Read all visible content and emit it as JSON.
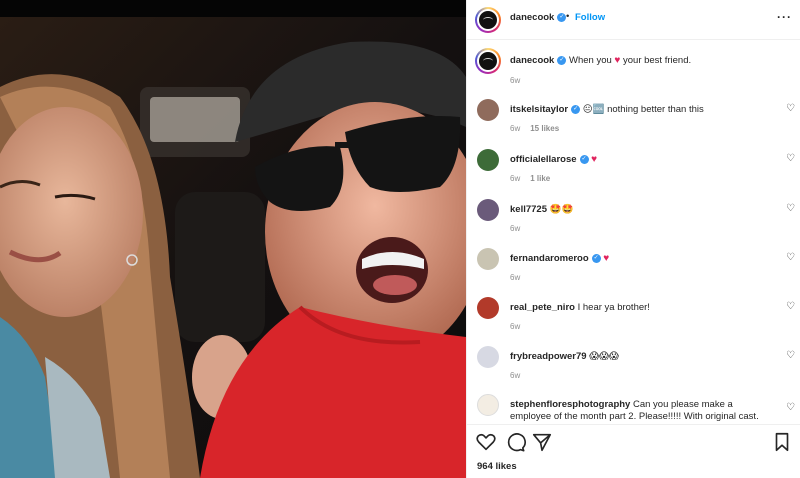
{
  "post": {
    "author": "danecook",
    "follow_label": "Follow",
    "separator": "•",
    "more_label": "···",
    "caption_text": "When you",
    "caption_text_end": "your best friend.",
    "caption_time": "6w",
    "likes": "964 likes"
  },
  "comments": [
    {
      "user": "itskelsitaylor",
      "verified": true,
      "text": "😐🆒 nothing better than this",
      "time": "6w",
      "likes": "15 likes"
    },
    {
      "user": "officialellarose",
      "verified": true,
      "text": "♥",
      "time": "6w",
      "likes": "1 like"
    },
    {
      "user": "kell7725",
      "verified": false,
      "text": "🤩🤩",
      "time": "6w",
      "likes": ""
    },
    {
      "user": "fernandaromeroo",
      "verified": true,
      "text": "♥",
      "time": "6w",
      "likes": ""
    },
    {
      "user": "real_pete_niro",
      "verified": false,
      "text": "I hear ya brother!",
      "time": "6w",
      "likes": ""
    },
    {
      "user": "frybreadpower79",
      "verified": false,
      "text": "😱😱😱",
      "time": "6w",
      "likes": ""
    },
    {
      "user": "stephenfloresphotography",
      "verified": false,
      "text": "Can you please make a employee of the month part 2. Please!!!!! With original cast.",
      "time": "",
      "likes": ""
    }
  ],
  "icons": {
    "verified": "checkmark",
    "heart_outline": "♡",
    "heart_red": "♥",
    "like": "heart-icon",
    "comment": "comment-icon",
    "share": "share-icon",
    "save": "bookmark-icon"
  },
  "colors": {
    "link_blue": "#0095f6",
    "verified_blue": "#3897f0",
    "heart_red": "#e0245e",
    "muted": "#8e8e8e",
    "shirt_red": "#d8252a"
  }
}
